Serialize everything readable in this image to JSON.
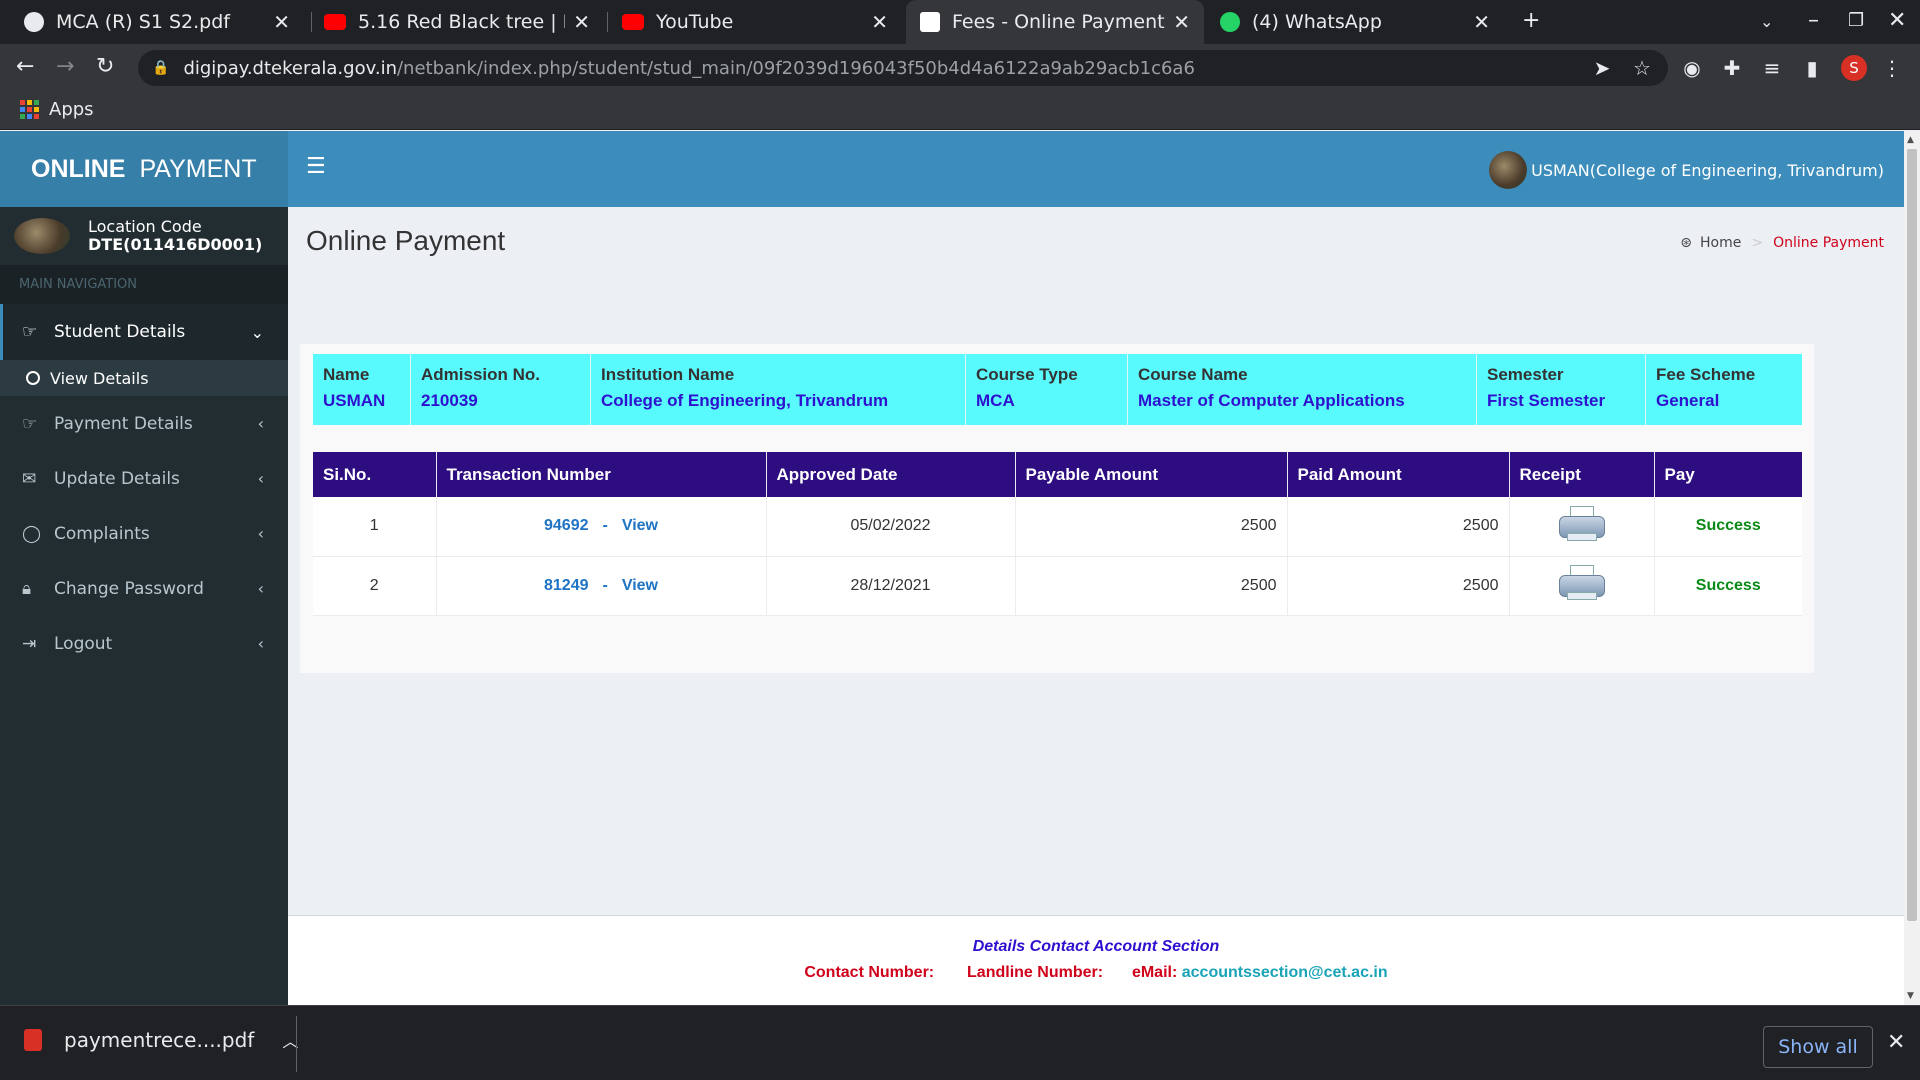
{
  "browser": {
    "tabs": [
      {
        "title": "MCA (R) S1 S2.pdf",
        "favicon_color": "#e8eaed",
        "favicon": "globe-icon"
      },
      {
        "title": "5.16 Red Black tree | Intro",
        "favicon_color": "#ff0000",
        "favicon": "youtube-icon"
      },
      {
        "title": "YouTube",
        "favicon_color": "#ff0000",
        "favicon": "youtube-icon"
      },
      {
        "title": "Fees - Online Payment",
        "favicon_color": "#ffffff",
        "favicon": "site-icon"
      },
      {
        "title": "(4) WhatsApp",
        "favicon_color": "#25d366",
        "favicon": "whatsapp-icon"
      }
    ],
    "url_host": "digipay.dtekerala.gov.in",
    "url_path": "/netbank/index.php/student/stud_main/09f2039d196043f50b4d4a6122a9ab29acb1c6a6",
    "bookmarks_apps": "Apps",
    "profile_initial": "S"
  },
  "sidebar": {
    "logo_bold": "ONLINE",
    "logo_rest": "PAYMENT",
    "location_label": "Location Code",
    "location_code": "DTE(011416D0001)",
    "nav_header": "MAIN NAVIGATION",
    "items": [
      {
        "label": "Student Details",
        "icon": "hand-point-icon",
        "arrow": "⌄"
      },
      {
        "label": "Payment Details",
        "icon": "hand-point-icon",
        "arrow": "‹"
      },
      {
        "label": "Update Details",
        "icon": "envelope-icon",
        "arrow": "‹"
      },
      {
        "label": "Complaints",
        "icon": "comment-icon",
        "arrow": "‹"
      },
      {
        "label": "Change Password",
        "icon": "lock-icon",
        "arrow": "‹"
      },
      {
        "label": "Logout",
        "icon": "sign-out-icon",
        "arrow": "‹"
      }
    ],
    "sub_item": "View Details"
  },
  "header": {
    "user": "USMAN(College of Engineering, Trivandrum)"
  },
  "content": {
    "page_title": "Online Payment",
    "breadcrumb_home": "Home",
    "breadcrumb_current": "Online Payment",
    "student_info": [
      {
        "label": "Name",
        "value": "USMAN"
      },
      {
        "label": "Admission No.",
        "value": "210039"
      },
      {
        "label": "Institution Name",
        "value": "College of Engineering, Trivandrum"
      },
      {
        "label": "Course Type",
        "value": "MCA"
      },
      {
        "label": "Course Name",
        "value": "Master of Computer Applications"
      },
      {
        "label": "Semester",
        "value": "First Semester"
      },
      {
        "label": "Fee Scheme",
        "value": "General"
      }
    ],
    "table_headers": [
      "Si.No.",
      "Transaction Number",
      "Approved Date",
      "Payable Amount",
      "Paid Amount",
      "Receipt",
      "Pay"
    ],
    "view_label": "View",
    "rows": [
      {
        "sino": "1",
        "txn": "94692",
        "date": "05/02/2022",
        "payable": "2500",
        "paid": "2500",
        "status": "Success"
      },
      {
        "sino": "2",
        "txn": "81249",
        "date": "28/12/2021",
        "payable": "2500",
        "paid": "2500",
        "status": "Success"
      }
    ]
  },
  "footer": {
    "line1": "Details Contact Account Section",
    "contact_label": "Contact Number:",
    "landline_label": "Landline Number:",
    "email_label": "eMail:",
    "email": "accountssection@cet.ac.in"
  },
  "downloads": {
    "file": "paymentrece....pdf",
    "show_all": "Show all"
  }
}
